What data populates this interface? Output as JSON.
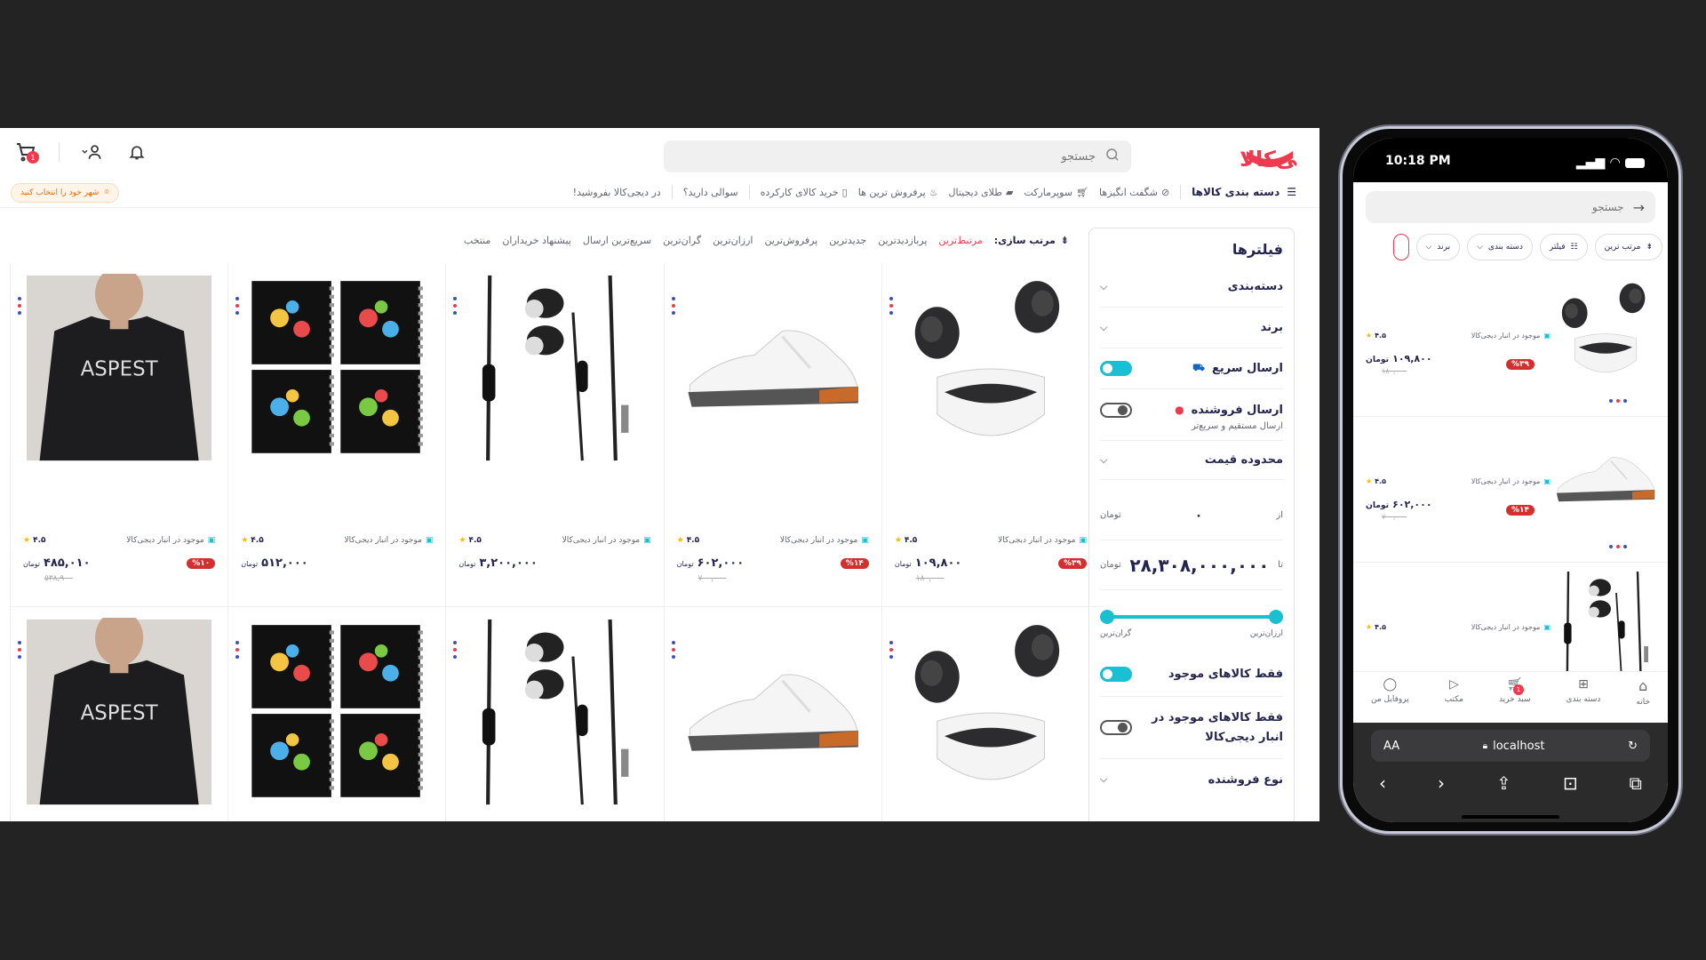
{
  "desktop": {
    "logo_text": "دیجی‌کالا",
    "search_placeholder": "جستجو",
    "cart_count": "1",
    "city_label": "شهر خود را انتخاب کنید",
    "nav": {
      "categories": "دسته بندی کالاها",
      "items": [
        "شگفت انگیزها",
        "سوپرمارکت",
        "طلای دیجیتال",
        "پرفروش ترین ها",
        "خرید کالای کارکرده",
        "سوالی دارید؟",
        "در دیجی‌کالا بفروشید!"
      ]
    },
    "filters": {
      "title": "فیلترها",
      "category": "دسته‌بندی",
      "brand": "برند",
      "fast_shipping": "ارسال سریع",
      "seller_shipping": "ارسال فروشنده",
      "seller_shipping_sub": "ارسال مستقیم و سریع‌تر",
      "price_range": "محدوده قیمت",
      "from_label": "از",
      "from_value": "۰",
      "to_label": "تا",
      "to_value": "۲۸,۳۰۸,۰۰۰,۰۰۰",
      "currency": "تومان",
      "cheapest": "ارزان‌ترین",
      "most_expensive": "گران‌ترین",
      "available_only": "فقط کالاهای موجود",
      "warehouse_only": "فقط کالاهای موجود در انبار دیجی‌کالا",
      "seller_type": "نوع فروشنده",
      "fast_shipping_on": true,
      "seller_shipping_on": false,
      "available_only_on": true,
      "warehouse_only_on": false
    },
    "sort": {
      "title": "مرتب سازی:",
      "options": [
        "مرتبط‌ترین",
        "پربازدیدترین",
        "جدیدترین",
        "پرفروش‌ترین",
        "ارزان‌ترین",
        "گران‌ترین",
        "سریع‌ترین ارسال",
        "پیشنهاد خریداران",
        "منتخب"
      ],
      "active": "مرتبط‌ترین"
    },
    "stock_text": "موجود در انبار دیجی‌کالا",
    "currency": "تومان",
    "products": [
      {
        "type": "earbuds",
        "discount": "%۳۹",
        "price": "۱۰۹,۸۰۰",
        "old_price": "۱۸۰,۰۰۰",
        "rating": "۴.۵"
      },
      {
        "type": "shoe",
        "discount": "%۱۴",
        "price": "۶۰۲,۰۰۰",
        "old_price": "۷۰۰,۰۰۰",
        "rating": "۴.۵"
      },
      {
        "type": "earphones",
        "discount": "",
        "price": "۳,۲۰۰,۰۰۰",
        "old_price": "",
        "rating": "۴.۵"
      },
      {
        "type": "notebooks",
        "discount": "",
        "price": "۵۱۲,۰۰۰",
        "old_price": "",
        "rating": "۴.۵"
      },
      {
        "type": "tshirt",
        "discount": "%۱۰",
        "price": "۴۸۵,۰۱۰",
        "old_price": "۵۳۸,۹۰۰",
        "rating": "۴.۵",
        "shirt_text": "ASPEST"
      },
      {
        "type": "earbuds"
      },
      {
        "type": "shoe"
      },
      {
        "type": "earphones"
      },
      {
        "type": "notebooks"
      },
      {
        "type": "tshirt",
        "shirt_text": "ASPEST"
      }
    ]
  },
  "phone": {
    "time": "10:18 PM",
    "search_placeholder": "جستجو",
    "chips": [
      "مرتب ترین",
      "فیلتر",
      "دسته بندی",
      "برند"
    ],
    "stock_text": "موجود در انبار دیجی‌کالا",
    "currency": "تومان",
    "products": [
      {
        "type": "earbuds",
        "discount": "%۳۹",
        "price": "۱۰۹,۸۰۰",
        "old_price": "۱۸۰,۰۰۰",
        "rating": "۴.۵"
      },
      {
        "type": "shoe",
        "discount": "%۱۴",
        "price": "۶۰۲,۰۰۰",
        "old_price": "۷۰۰,۰۰۰",
        "rating": "۴.۵"
      },
      {
        "type": "earphones",
        "rating": "۴.۵"
      }
    ],
    "tabs": [
      "خانه",
      "دسته بندی",
      "سبد خرید",
      "مکتب",
      "پروفایل من"
    ],
    "cart_count": "1",
    "url": "localhost",
    "aa": "AA"
  },
  "colors": {
    "brand": "#ef394e",
    "accent": "#19bfd3",
    "dark": "#23254e"
  }
}
